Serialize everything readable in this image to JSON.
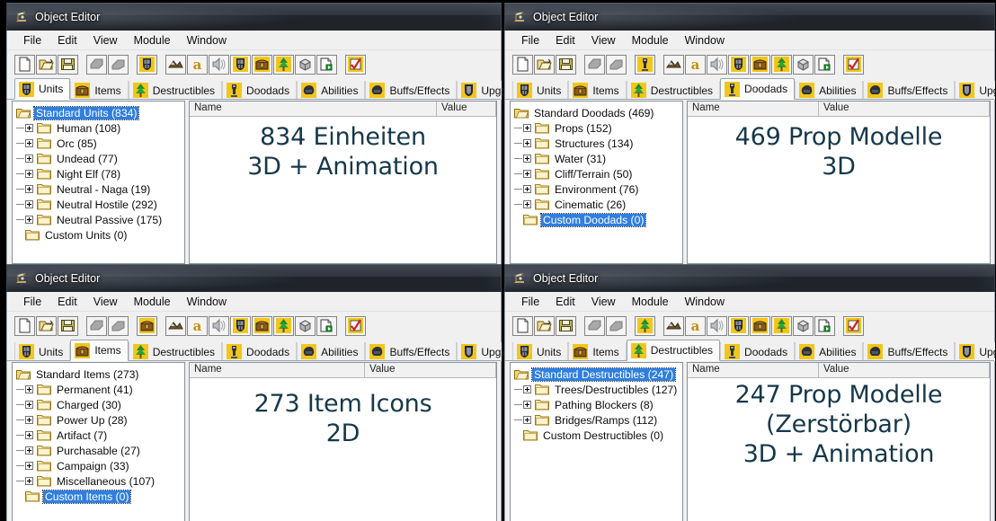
{
  "window_title": "Object Editor",
  "app_icon": "object-editor-icon",
  "menu": [
    "File",
    "Edit",
    "View",
    "Module",
    "Window"
  ],
  "toolbar_icons": [
    "new-document-icon",
    "open-folder-icon",
    "save-disk-icon",
    "sep",
    "copy-grey-icon",
    "paste-grey-icon",
    "sep",
    "module-current-icon",
    "sep",
    "terrain-icon",
    "text-a-icon",
    "sound-icon",
    "unit-helm-icon",
    "item-chest-icon",
    "destructible-tree-icon",
    "doodad-cube-icon",
    "upgrade-page-icon",
    "sep",
    "checkbox-red-icon"
  ],
  "tabs": [
    {
      "label": "Units",
      "icon": "unit-helm-icon"
    },
    {
      "label": "Items",
      "icon": "item-chest-icon"
    },
    {
      "label": "Destructibles",
      "icon": "tree-icon"
    },
    {
      "label": "Doodads",
      "icon": "doodad-statue-icon"
    },
    {
      "label": "Abilities",
      "icon": "ability-fist-icon"
    },
    {
      "label": "Buffs/Effects",
      "icon": "buff-fist-icon"
    },
    {
      "label": "Upgrades",
      "icon": "upgrade-shield-icon"
    }
  ],
  "columns": [
    "Name",
    "Value"
  ],
  "panels": [
    {
      "id": "units-panel",
      "active_tab": "Units",
      "toolbar_module_icon": "unit-helm-icon",
      "overlay": "834 Einheiten\n3D + Animation",
      "overlay_lines": [
        "834 Einheiten",
        "3D + Animation"
      ],
      "tree": [
        {
          "label": "Standard Units (834)",
          "depth": 0,
          "expander": "open",
          "selected": true
        },
        {
          "label": "Human (108)",
          "depth": 1,
          "expander": "plus",
          "selected": false
        },
        {
          "label": "Orc (85)",
          "depth": 1,
          "expander": "plus",
          "selected": false
        },
        {
          "label": "Undead (77)",
          "depth": 1,
          "expander": "plus",
          "selected": false
        },
        {
          "label": "Night Elf (78)",
          "depth": 1,
          "expander": "plus",
          "selected": false
        },
        {
          "label": "Neutral - Naga (19)",
          "depth": 1,
          "expander": "plus",
          "selected": false
        },
        {
          "label": "Neutral Hostile (292)",
          "depth": 1,
          "expander": "plus",
          "selected": false
        },
        {
          "label": "Neutral Passive (175)",
          "depth": 1,
          "expander": "plus",
          "selected": false
        },
        {
          "label": "Custom Units (0)",
          "depth": 0,
          "expander": "none",
          "selected": false
        }
      ]
    },
    {
      "id": "doodads-panel",
      "active_tab": "Doodads",
      "toolbar_module_icon": "doodad-statue-icon",
      "overlay": "469 Prop Modelle\n3D",
      "overlay_lines": [
        "469 Prop Modelle",
        "3D"
      ],
      "tree": [
        {
          "label": "Standard Doodads (469)",
          "depth": 0,
          "expander": "open",
          "selected": false
        },
        {
          "label": "Props (152)",
          "depth": 1,
          "expander": "plus",
          "selected": false
        },
        {
          "label": "Structures (134)",
          "depth": 1,
          "expander": "plus",
          "selected": false
        },
        {
          "label": "Water (31)",
          "depth": 1,
          "expander": "plus",
          "selected": false
        },
        {
          "label": "Cliff/Terrain (50)",
          "depth": 1,
          "expander": "plus",
          "selected": false
        },
        {
          "label": "Environment (76)",
          "depth": 1,
          "expander": "plus",
          "selected": false
        },
        {
          "label": "Cinematic (26)",
          "depth": 1,
          "expander": "plus",
          "selected": false
        },
        {
          "label": "Custom Doodads (0)",
          "depth": 0,
          "expander": "none",
          "selected": true
        }
      ]
    },
    {
      "id": "items-panel",
      "active_tab": "Items",
      "toolbar_module_icon": "item-chest-icon",
      "overlay": "273 Item Icons\n2D",
      "overlay_lines": [
        "273 Item Icons",
        "2D"
      ],
      "tree": [
        {
          "label": "Standard Items (273)",
          "depth": 0,
          "expander": "open",
          "selected": false
        },
        {
          "label": "Permanent (41)",
          "depth": 1,
          "expander": "plus",
          "selected": false
        },
        {
          "label": "Charged (30)",
          "depth": 1,
          "expander": "plus",
          "selected": false
        },
        {
          "label": "Power Up (28)",
          "depth": 1,
          "expander": "plus",
          "selected": false
        },
        {
          "label": "Artifact (7)",
          "depth": 1,
          "expander": "plus",
          "selected": false
        },
        {
          "label": "Purchasable (27)",
          "depth": 1,
          "expander": "plus",
          "selected": false
        },
        {
          "label": "Campaign (33)",
          "depth": 1,
          "expander": "plus",
          "selected": false
        },
        {
          "label": "Miscellaneous (107)",
          "depth": 1,
          "expander": "plus",
          "selected": false
        },
        {
          "label": "Custom Items (0)",
          "depth": 0,
          "expander": "none",
          "selected": true
        }
      ]
    },
    {
      "id": "destructibles-panel",
      "active_tab": "Destructibles",
      "toolbar_module_icon": "tree-icon",
      "overlay": "247 Prop Modelle\n(Zerstörbar)\n3D + Animation",
      "overlay_lines": [
        "247 Prop Modelle",
        "(Zerstörbar)",
        "3D + Animation"
      ],
      "tree": [
        {
          "label": "Standard Destructibles (247)",
          "depth": 0,
          "expander": "open",
          "selected": true
        },
        {
          "label": "Trees/Destructibles (127)",
          "depth": 1,
          "expander": "plus",
          "selected": false
        },
        {
          "label": "Pathing Blockers (8)",
          "depth": 1,
          "expander": "plus",
          "selected": false
        },
        {
          "label": "Bridges/Ramps (112)",
          "depth": 1,
          "expander": "plus",
          "selected": false
        },
        {
          "label": "Custom Destructibles (0)",
          "depth": 0,
          "expander": "none",
          "selected": false
        }
      ]
    }
  ],
  "colors": {
    "selection_blue": "#2f7fe0",
    "overlay_text": "#16384a",
    "titlebar_dark": "#1b1f25",
    "window_face": "#f0f0f0"
  }
}
